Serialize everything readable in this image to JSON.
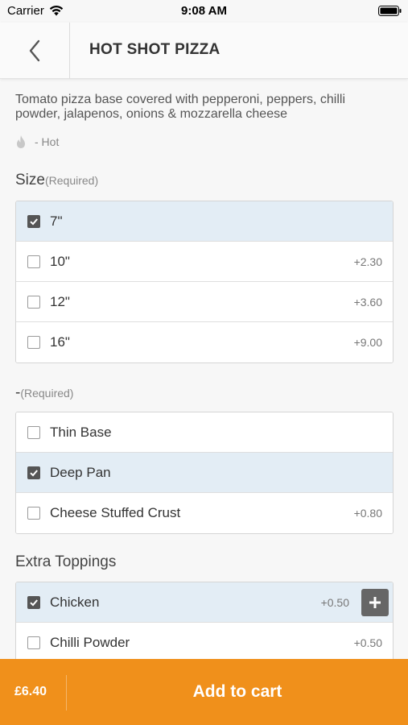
{
  "status_bar": {
    "carrier": "Carrier",
    "time": "9:08 AM"
  },
  "nav": {
    "title": "HOT SHOT PIZZA",
    "back_icon": "chevron-left-icon"
  },
  "product": {
    "description": "Tomato pizza base covered with pepperoni, peppers, chilli powder, jalapenos, onions & mozzarella cheese",
    "hot_label": "- Hot",
    "hot_icon": "flame-icon"
  },
  "sections": {
    "size": {
      "title": "Size",
      "required": "(Required)",
      "options": [
        {
          "label": "7\"",
          "price": "",
          "checked": true
        },
        {
          "label": "10\"",
          "price": "+2.30",
          "checked": false
        },
        {
          "label": "12\"",
          "price": "+3.60",
          "checked": false
        },
        {
          "label": "16\"",
          "price": "+9.00",
          "checked": false
        }
      ]
    },
    "base": {
      "title": "-",
      "required": "(Required)",
      "options": [
        {
          "label": "Thin Base",
          "price": "",
          "checked": false
        },
        {
          "label": "Deep Pan",
          "price": "",
          "checked": true
        },
        {
          "label": "Cheese Stuffed Crust",
          "price": "+0.80",
          "checked": false
        }
      ]
    },
    "toppings": {
      "title": "Extra Toppings",
      "options": [
        {
          "label": "Chicken",
          "price": "+0.50",
          "checked": true
        },
        {
          "label": "Chilli Powder",
          "price": "+0.50",
          "checked": false
        }
      ]
    }
  },
  "cart": {
    "total": "£6.40",
    "button_label": "Add to cart"
  },
  "colors": {
    "accent": "#f0901b",
    "selected_row": "#e3edf5"
  }
}
